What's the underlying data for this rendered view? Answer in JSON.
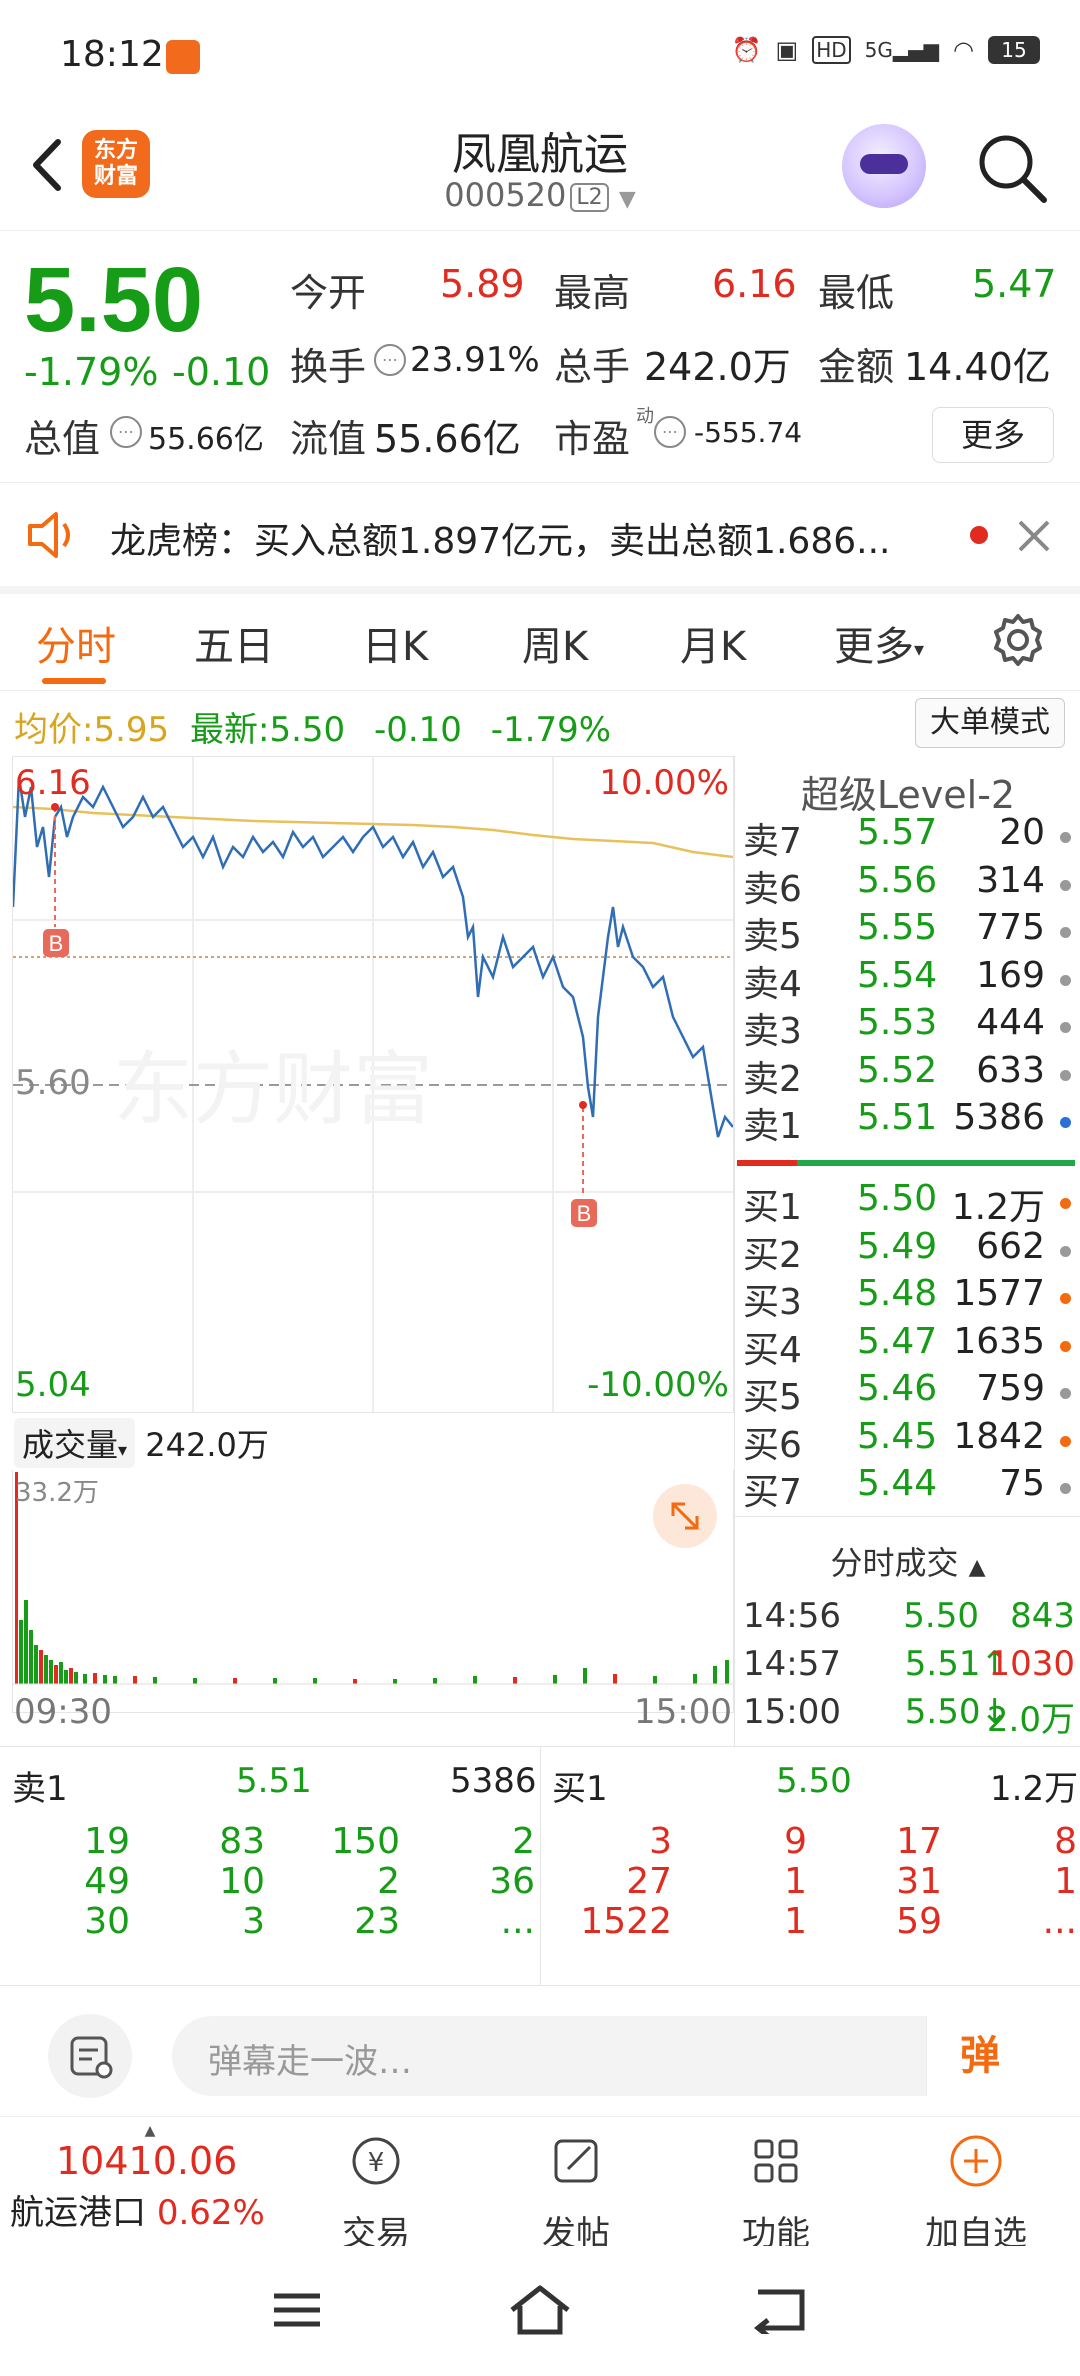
{
  "status_bar": {
    "time": "18:12",
    "battery": "15",
    "network": "5G"
  },
  "header": {
    "title": "凤凰航运",
    "code": "000520",
    "badge": "L2",
    "logo_line1": "东方",
    "logo_line2": "财富"
  },
  "quote": {
    "price": "5.50",
    "pct": "-1.79%",
    "chg": "-0.10",
    "open_label": "今开",
    "open": "5.89",
    "high_label": "最高",
    "high": "6.16",
    "low_label": "最低",
    "low": "5.47",
    "turnover_label": "换手",
    "turnover": "23.91%",
    "volume_label": "总手",
    "volume": "242.0万",
    "amount_label": "金额",
    "amount": "14.40亿",
    "mktcap_label": "总值",
    "mktcap": "55.66亿",
    "float_label": "流值",
    "float_cap": "55.66亿",
    "pe_label": "市盈",
    "pe_sup": "动",
    "pe": "-555.74",
    "more_label": "更多"
  },
  "notice": {
    "text": "龙虎榜：买入总额1.897亿元，卖出总额1.686..."
  },
  "tabs": [
    "分时",
    "五日",
    "日K",
    "周K",
    "月K",
    "更多"
  ],
  "chart": {
    "avg_label": "均价:",
    "avg": "5.95",
    "latest_label": "最新:",
    "latest": "5.50",
    "latest_chg": "-0.10",
    "latest_pct": "-1.79%",
    "big_mode": "大单模式",
    "top_price": "6.16",
    "top_pct": "10.00%",
    "mid_price": "5.60",
    "bottom_price": "5.04",
    "bottom_pct": "-10.00%",
    "marker": "B",
    "watermark": "东方财富",
    "volume_label": "成交量",
    "volume_value": "242.0万",
    "vol_max": "33.2万",
    "time_start": "09:30",
    "time_end": "15:00"
  },
  "orderbook": {
    "title": "超级Level-2",
    "asks": [
      {
        "label": "卖7",
        "price": "5.57",
        "vol": "20",
        "dot": "#999999"
      },
      {
        "label": "卖6",
        "price": "5.56",
        "vol": "314",
        "dot": "#999999"
      },
      {
        "label": "卖5",
        "price": "5.55",
        "vol": "775",
        "dot": "#999999"
      },
      {
        "label": "卖4",
        "price": "5.54",
        "vol": "169",
        "dot": "#999999"
      },
      {
        "label": "卖3",
        "price": "5.53",
        "vol": "444",
        "dot": "#999999"
      },
      {
        "label": "卖2",
        "price": "5.52",
        "vol": "633",
        "dot": "#999999"
      },
      {
        "label": "卖1",
        "price": "5.51",
        "vol": "5386",
        "dot": "#2a6fd6"
      }
    ],
    "bids": [
      {
        "label": "买1",
        "price": "5.50",
        "vol": "1.2万",
        "dot": "#f36a10"
      },
      {
        "label": "买2",
        "price": "5.49",
        "vol": "662",
        "dot": "#999999"
      },
      {
        "label": "买3",
        "price": "5.48",
        "vol": "1577",
        "dot": "#f36a10"
      },
      {
        "label": "买4",
        "price": "5.47",
        "vol": "1635",
        "dot": "#f36a10"
      },
      {
        "label": "买5",
        "price": "5.46",
        "vol": "759",
        "dot": "#999999"
      },
      {
        "label": "买6",
        "price": "5.45",
        "vol": "1842",
        "dot": "#f36a10"
      },
      {
        "label": "买7",
        "price": "5.44",
        "vol": "75",
        "dot": "#999999"
      }
    ],
    "ticks_title": "分时成交",
    "ticks": [
      {
        "time": "14:56",
        "price": "5.50",
        "vol": "843"
      },
      {
        "time": "14:57",
        "price": "5.51↑",
        "vol": "1030"
      },
      {
        "time": "15:00",
        "price": "5.50↓",
        "vol": "2.0万"
      }
    ]
  },
  "level1": {
    "ask_label": "卖1",
    "ask_price": "5.51",
    "ask_vol": "5386",
    "bid_label": "买1",
    "bid_price": "5.50",
    "bid_vol": "1.2万",
    "ask_queue": [
      [
        "19",
        "83",
        "150",
        "2"
      ],
      [
        "49",
        "10",
        "2",
        "36"
      ],
      [
        "30",
        "3",
        "23",
        "..."
      ]
    ],
    "bid_queue": [
      [
        "3",
        "9",
        "17",
        "8"
      ],
      [
        "27",
        "1",
        "31",
        "1"
      ],
      [
        "1522",
        "1",
        "59",
        "..."
      ]
    ]
  },
  "comment": {
    "placeholder": "弹幕走一波…",
    "danmu": "弹"
  },
  "bottom_nav": {
    "index_value": "10410.06",
    "index_name": "航运港口",
    "index_pct": "0.62%",
    "items": [
      "交易",
      "发帖",
      "功能",
      "加自选"
    ]
  },
  "colors": {
    "up": "#e02b20",
    "down": "#169c16",
    "accent": "#f36a10",
    "avg_line": "#e8c15a",
    "price_line": "#2f6db5"
  }
}
